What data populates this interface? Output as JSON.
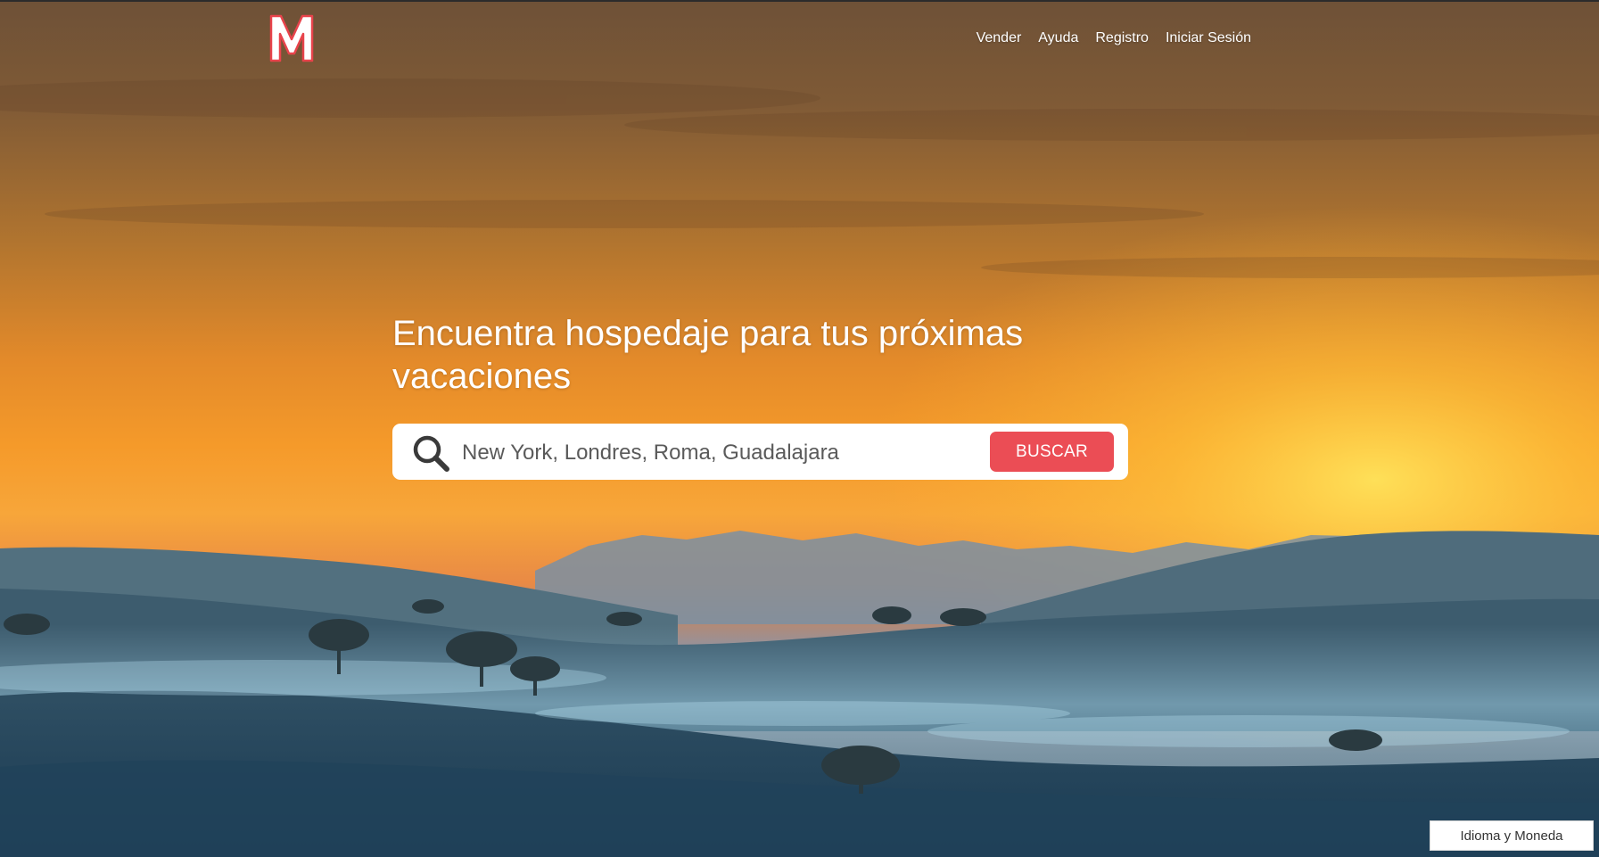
{
  "brand": {
    "logo_letter": "M",
    "logo_fill": "#ffffff",
    "logo_outline": "#e8434b"
  },
  "nav": {
    "items": [
      "Vender",
      "Ayuda",
      "Registro",
      "Iniciar Sesión"
    ]
  },
  "hero": {
    "headline": "Encuentra hospedaje para tus próximas vacaciones",
    "background": "sunset-over-misty-hills"
  },
  "search": {
    "icon": "search-icon",
    "placeholder": "New York, Londres, Roma, Guadalajara",
    "button_label": "BUSCAR",
    "button_color": "#eb4d55"
  },
  "footer": {
    "language_currency_label": "Idioma y Moneda"
  }
}
